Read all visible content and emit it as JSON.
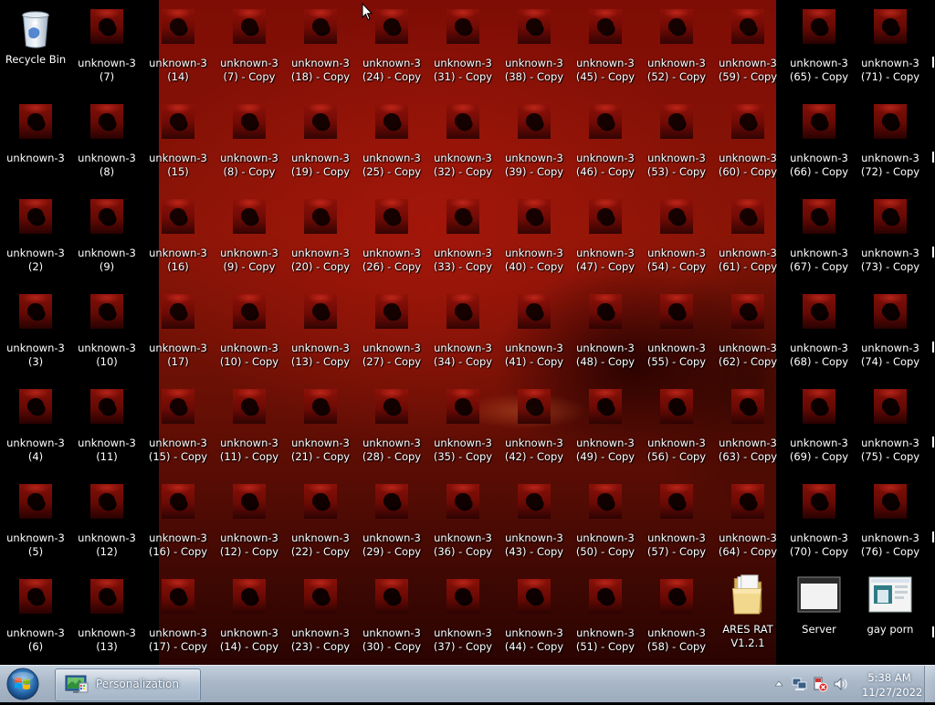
{
  "desktop": {
    "icons": [
      {
        "col": 0,
        "row": 0,
        "type": "bin",
        "lines": [
          "Recycle Bin"
        ]
      },
      {
        "col": 1,
        "row": 0,
        "type": "image",
        "lines": [
          "unknown-3",
          "(7)"
        ]
      },
      {
        "col": 2,
        "row": 0,
        "type": "image",
        "lines": [
          "unknown-3",
          "(14)"
        ]
      },
      {
        "col": 3,
        "row": 0,
        "type": "image",
        "lines": [
          "unknown-3",
          "(7) - Copy"
        ]
      },
      {
        "col": 4,
        "row": 0,
        "type": "image",
        "lines": [
          "unknown-3",
          "(18) - Copy"
        ]
      },
      {
        "col": 5,
        "row": 0,
        "type": "image",
        "lines": [
          "unknown-3",
          "(24) - Copy"
        ]
      },
      {
        "col": 6,
        "row": 0,
        "type": "image",
        "lines": [
          "unknown-3",
          "(31) - Copy"
        ]
      },
      {
        "col": 7,
        "row": 0,
        "type": "image",
        "lines": [
          "unknown-3",
          "(38) - Copy"
        ]
      },
      {
        "col": 8,
        "row": 0,
        "type": "image",
        "lines": [
          "unknown-3",
          "(45) - Copy"
        ]
      },
      {
        "col": 9,
        "row": 0,
        "type": "image",
        "lines": [
          "unknown-3",
          "(52) - Copy"
        ]
      },
      {
        "col": 10,
        "row": 0,
        "type": "image",
        "lines": [
          "unknown-3",
          "(59) - Copy"
        ]
      },
      {
        "col": 11,
        "row": 0,
        "type": "image",
        "lines": [
          "unknown-3",
          "(65) - Copy"
        ]
      },
      {
        "col": 12,
        "row": 0,
        "type": "image",
        "lines": [
          "unknown-3",
          "(71) - Copy"
        ]
      },
      {
        "col": 0,
        "row": 1,
        "type": "image",
        "lines": [
          "unknown-3"
        ]
      },
      {
        "col": 1,
        "row": 1,
        "type": "image",
        "lines": [
          "unknown-3",
          "(8)"
        ]
      },
      {
        "col": 2,
        "row": 1,
        "type": "image",
        "lines": [
          "unknown-3",
          "(15)"
        ]
      },
      {
        "col": 3,
        "row": 1,
        "type": "image",
        "lines": [
          "unknown-3",
          "(8) - Copy"
        ]
      },
      {
        "col": 4,
        "row": 1,
        "type": "image",
        "lines": [
          "unknown-3",
          "(19) - Copy"
        ]
      },
      {
        "col": 5,
        "row": 1,
        "type": "image",
        "lines": [
          "unknown-3",
          "(25) - Copy"
        ]
      },
      {
        "col": 6,
        "row": 1,
        "type": "image",
        "lines": [
          "unknown-3",
          "(32) - Copy"
        ]
      },
      {
        "col": 7,
        "row": 1,
        "type": "image",
        "lines": [
          "unknown-3",
          "(39) - Copy"
        ]
      },
      {
        "col": 8,
        "row": 1,
        "type": "image",
        "lines": [
          "unknown-3",
          "(46) - Copy"
        ]
      },
      {
        "col": 9,
        "row": 1,
        "type": "image",
        "lines": [
          "unknown-3",
          "(53) - Copy"
        ]
      },
      {
        "col": 10,
        "row": 1,
        "type": "image",
        "lines": [
          "unknown-3",
          "(60) - Copy"
        ]
      },
      {
        "col": 11,
        "row": 1,
        "type": "image",
        "lines": [
          "unknown-3",
          "(66) - Copy"
        ]
      },
      {
        "col": 12,
        "row": 1,
        "type": "image",
        "lines": [
          "unknown-3",
          "(72) - Copy"
        ]
      },
      {
        "col": 0,
        "row": 2,
        "type": "image",
        "lines": [
          "unknown-3",
          "(2)"
        ]
      },
      {
        "col": 1,
        "row": 2,
        "type": "image",
        "lines": [
          "unknown-3",
          "(9)"
        ]
      },
      {
        "col": 2,
        "row": 2,
        "type": "image",
        "lines": [
          "unknown-3",
          "(16)"
        ]
      },
      {
        "col": 3,
        "row": 2,
        "type": "image",
        "lines": [
          "unknown-3",
          "(9) - Copy"
        ]
      },
      {
        "col": 4,
        "row": 2,
        "type": "image",
        "lines": [
          "unknown-3",
          "(20) - Copy"
        ]
      },
      {
        "col": 5,
        "row": 2,
        "type": "image",
        "lines": [
          "unknown-3",
          "(26) - Copy"
        ]
      },
      {
        "col": 6,
        "row": 2,
        "type": "image",
        "lines": [
          "unknown-3",
          "(33) - Copy"
        ]
      },
      {
        "col": 7,
        "row": 2,
        "type": "image",
        "lines": [
          "unknown-3",
          "(40) - Copy"
        ]
      },
      {
        "col": 8,
        "row": 2,
        "type": "image",
        "lines": [
          "unknown-3",
          "(47) - Copy"
        ]
      },
      {
        "col": 9,
        "row": 2,
        "type": "image",
        "lines": [
          "unknown-3",
          "(54) - Copy"
        ]
      },
      {
        "col": 10,
        "row": 2,
        "type": "image",
        "lines": [
          "unknown-3",
          "(61) - Copy"
        ]
      },
      {
        "col": 11,
        "row": 2,
        "type": "image",
        "lines": [
          "unknown-3",
          "(67) - Copy"
        ]
      },
      {
        "col": 12,
        "row": 2,
        "type": "image",
        "lines": [
          "unknown-3",
          "(73) - Copy"
        ]
      },
      {
        "col": 0,
        "row": 3,
        "type": "image",
        "lines": [
          "unknown-3",
          "(3)"
        ]
      },
      {
        "col": 1,
        "row": 3,
        "type": "image",
        "lines": [
          "unknown-3",
          "(10)"
        ]
      },
      {
        "col": 2,
        "row": 3,
        "type": "image",
        "lines": [
          "unknown-3",
          "(17)"
        ]
      },
      {
        "col": 3,
        "row": 3,
        "type": "image",
        "lines": [
          "unknown-3",
          "(10) - Copy"
        ]
      },
      {
        "col": 4,
        "row": 3,
        "type": "image",
        "lines": [
          "unknown-3",
          "(13) - Copy"
        ]
      },
      {
        "col": 5,
        "row": 3,
        "type": "image",
        "lines": [
          "unknown-3",
          "(27) - Copy"
        ]
      },
      {
        "col": 6,
        "row": 3,
        "type": "image",
        "lines": [
          "unknown-3",
          "(34) - Copy"
        ]
      },
      {
        "col": 7,
        "row": 3,
        "type": "image",
        "lines": [
          "unknown-3",
          "(41) - Copy"
        ]
      },
      {
        "col": 8,
        "row": 3,
        "type": "image",
        "lines": [
          "unknown-3",
          "(48) - Copy"
        ]
      },
      {
        "col": 9,
        "row": 3,
        "type": "image",
        "lines": [
          "unknown-3",
          "(55) - Copy"
        ]
      },
      {
        "col": 10,
        "row": 3,
        "type": "image",
        "lines": [
          "unknown-3",
          "(62) - Copy"
        ]
      },
      {
        "col": 11,
        "row": 3,
        "type": "image",
        "lines": [
          "unknown-3",
          "(68) - Copy"
        ]
      },
      {
        "col": 12,
        "row": 3,
        "type": "image",
        "lines": [
          "unknown-3",
          "(74) - Copy"
        ]
      },
      {
        "col": 0,
        "row": 4,
        "type": "image",
        "lines": [
          "unknown-3",
          "(4)"
        ]
      },
      {
        "col": 1,
        "row": 4,
        "type": "image",
        "lines": [
          "unknown-3",
          "(11)"
        ]
      },
      {
        "col": 2,
        "row": 4,
        "type": "image",
        "lines": [
          "unknown-3",
          "(15) - Copy"
        ]
      },
      {
        "col": 3,
        "row": 4,
        "type": "image",
        "lines": [
          "unknown-3",
          "(11) - Copy"
        ]
      },
      {
        "col": 4,
        "row": 4,
        "type": "image",
        "lines": [
          "unknown-3",
          "(21) - Copy"
        ]
      },
      {
        "col": 5,
        "row": 4,
        "type": "image",
        "lines": [
          "unknown-3",
          "(28) - Copy"
        ]
      },
      {
        "col": 6,
        "row": 4,
        "type": "image",
        "lines": [
          "unknown-3",
          "(35) - Copy"
        ]
      },
      {
        "col": 7,
        "row": 4,
        "type": "image",
        "lines": [
          "unknown-3",
          "(42) - Copy"
        ]
      },
      {
        "col": 8,
        "row": 4,
        "type": "image",
        "lines": [
          "unknown-3",
          "(49) - Copy"
        ]
      },
      {
        "col": 9,
        "row": 4,
        "type": "image",
        "lines": [
          "unknown-3",
          "(56) - Copy"
        ]
      },
      {
        "col": 10,
        "row": 4,
        "type": "image",
        "lines": [
          "unknown-3",
          "(63) - Copy"
        ]
      },
      {
        "col": 11,
        "row": 4,
        "type": "image",
        "lines": [
          "unknown-3",
          "(69) - Copy"
        ]
      },
      {
        "col": 12,
        "row": 4,
        "type": "image",
        "lines": [
          "unknown-3",
          "(75) - Copy"
        ]
      },
      {
        "col": 0,
        "row": 5,
        "type": "image",
        "lines": [
          "unknown-3",
          "(5)"
        ]
      },
      {
        "col": 1,
        "row": 5,
        "type": "image",
        "lines": [
          "unknown-3",
          "(12)"
        ]
      },
      {
        "col": 2,
        "row": 5,
        "type": "image",
        "lines": [
          "unknown-3",
          "(16) - Copy"
        ]
      },
      {
        "col": 3,
        "row": 5,
        "type": "image",
        "lines": [
          "unknown-3",
          "(12) - Copy"
        ]
      },
      {
        "col": 4,
        "row": 5,
        "type": "image",
        "lines": [
          "unknown-3",
          "(22) - Copy"
        ]
      },
      {
        "col": 5,
        "row": 5,
        "type": "image",
        "lines": [
          "unknown-3",
          "(29) - Copy"
        ]
      },
      {
        "col": 6,
        "row": 5,
        "type": "image",
        "lines": [
          "unknown-3",
          "(36) - Copy"
        ]
      },
      {
        "col": 7,
        "row": 5,
        "type": "image",
        "lines": [
          "unknown-3",
          "(43) - Copy"
        ]
      },
      {
        "col": 8,
        "row": 5,
        "type": "image",
        "lines": [
          "unknown-3",
          "(50) - Copy"
        ]
      },
      {
        "col": 9,
        "row": 5,
        "type": "image",
        "lines": [
          "unknown-3",
          "(57) - Copy"
        ]
      },
      {
        "col": 10,
        "row": 5,
        "type": "image",
        "lines": [
          "unknown-3",
          "(64) - Copy"
        ]
      },
      {
        "col": 11,
        "row": 5,
        "type": "image",
        "lines": [
          "unknown-3",
          "(70) - Copy"
        ]
      },
      {
        "col": 12,
        "row": 5,
        "type": "image",
        "lines": [
          "unknown-3",
          "(76) - Copy"
        ]
      },
      {
        "col": 0,
        "row": 6,
        "type": "image",
        "lines": [
          "unknown-3",
          "(6)"
        ]
      },
      {
        "col": 1,
        "row": 6,
        "type": "image",
        "lines": [
          "unknown-3",
          "(13)"
        ]
      },
      {
        "col": 2,
        "row": 6,
        "type": "image",
        "lines": [
          "unknown-3",
          "(17) - Copy"
        ]
      },
      {
        "col": 3,
        "row": 6,
        "type": "image",
        "lines": [
          "unknown-3",
          "(14) - Copy"
        ]
      },
      {
        "col": 4,
        "row": 6,
        "type": "image",
        "lines": [
          "unknown-3",
          "(23) - Copy"
        ]
      },
      {
        "col": 5,
        "row": 6,
        "type": "image",
        "lines": [
          "unknown-3",
          "(30) - Copy"
        ]
      },
      {
        "col": 6,
        "row": 6,
        "type": "image",
        "lines": [
          "unknown-3",
          "(37) - Copy"
        ]
      },
      {
        "col": 7,
        "row": 6,
        "type": "image",
        "lines": [
          "unknown-3",
          "(44) - Copy"
        ]
      },
      {
        "col": 8,
        "row": 6,
        "type": "image",
        "lines": [
          "unknown-3",
          "(51) - Copy"
        ]
      },
      {
        "col": 9,
        "row": 6,
        "type": "image",
        "lines": [
          "unknown-3",
          "(58) - Copy"
        ]
      },
      {
        "col": 10,
        "row": 6,
        "type": "folder",
        "lines": [
          "ARES RAT",
          "V1.2.1"
        ]
      },
      {
        "col": 11,
        "row": 6,
        "type": "app-window",
        "lines": [
          "Server"
        ]
      },
      {
        "col": 12,
        "row": 6,
        "type": "app-image",
        "lines": [
          "gay porn"
        ]
      }
    ]
  },
  "taskbar": {
    "start_icon": "windows-logo-icon",
    "buttons": [
      {
        "label": "Personalization",
        "icon": "personalization-icon"
      }
    ],
    "tray_icons": [
      "show-hidden-icons-arrow",
      "network-icon",
      "action-center-icon",
      "volume-icon"
    ],
    "clock": {
      "time": "5:38 AM",
      "date": "11/27/2022"
    }
  },
  "colors": {
    "taskbar": "#a9b7c7",
    "wallpaper": "#8a1507"
  }
}
